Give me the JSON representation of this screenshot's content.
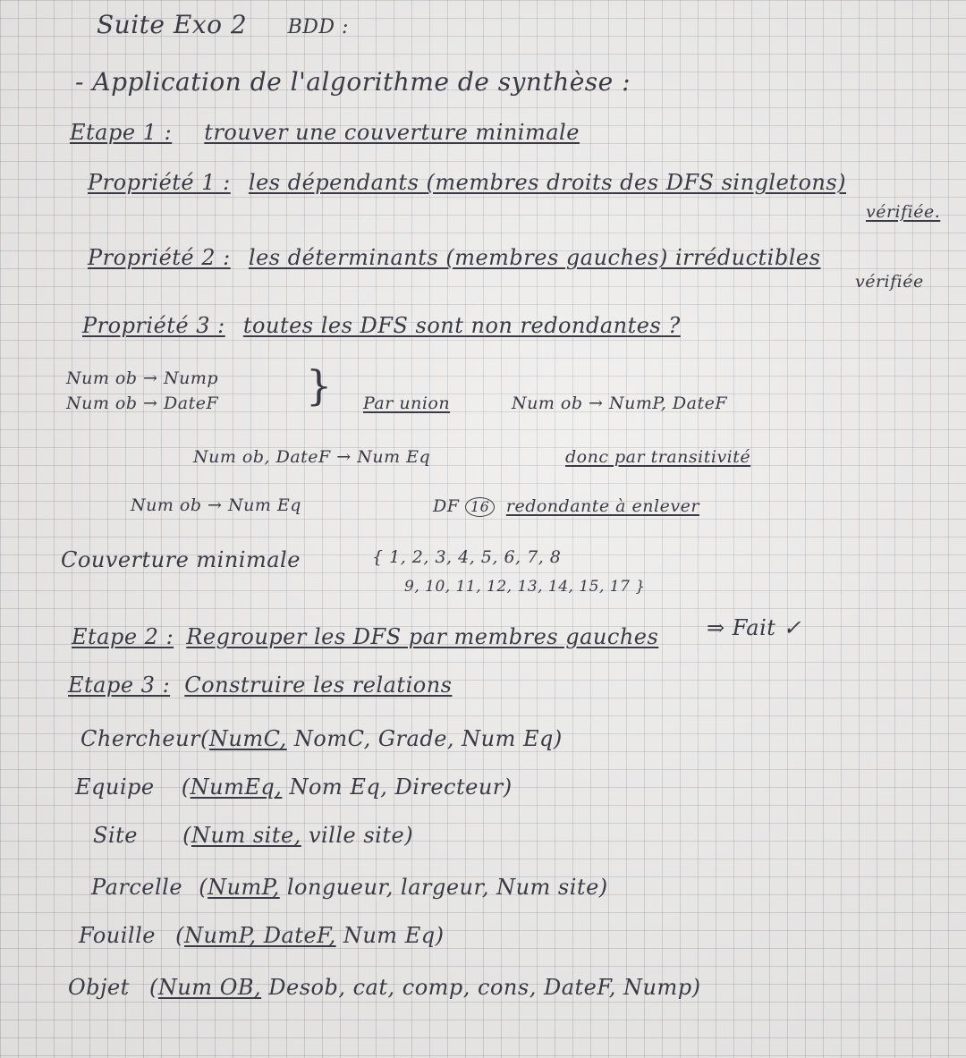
{
  "header": {
    "title": "Suite Exo 2",
    "subject": "BDD :"
  },
  "intro": "- Application de l'algorithme de synthèse :",
  "etape1": {
    "label": "Etape 1 :",
    "text": "trouver une couverture minimale"
  },
  "prop1": {
    "label": "Propriété 1 :",
    "text": "les dépendants (membres droits des DFS singletons)",
    "note": "vérifiée."
  },
  "prop2": {
    "label": "Propriété 2 :",
    "text": "les déterminants (membres gauches) irréductibles",
    "note": "vérifiée"
  },
  "prop3": {
    "label": "Propriété 3 :",
    "text": "toutes les DFS sont non redondantes ?"
  },
  "derivation": {
    "line1": "Num ob → Nump",
    "line2": "Num ob → DateF",
    "brace": "}",
    "union_label": "Par union",
    "union_result": "Num ob → NumP, DateF",
    "trans_left": "Num ob, DateF → Num Eq",
    "trans_right": "donc par transitivité",
    "result": "Num ob → Num Eq",
    "df_label": "DF",
    "df_number": "16",
    "df_note": "redondante à enlever"
  },
  "couverture": {
    "label": "Couverture minimale",
    "row1": "{ 1, 2, 3, 4, 5, 6, 7, 8",
    "row2": "9, 10, 11, 12, 13, 14, 15, 17 }"
  },
  "etape2": {
    "label": "Etape 2 :",
    "text": "Regrouper les DFS par membres gauches",
    "result": "⇒ Fait ✓"
  },
  "etape3": {
    "label": "Etape 3 :",
    "text": "Construire les relations"
  },
  "relations": [
    {
      "name": "Chercheur",
      "open": "(",
      "key": "NumC,",
      "rest": "NomC, Grade, Num Eq)"
    },
    {
      "name": "Equipe",
      "open": "(",
      "key": "NumEq,",
      "rest": "Nom Eq, Directeur)"
    },
    {
      "name": "Site",
      "open": "(",
      "key": "Num site,",
      "rest": "ville site)"
    },
    {
      "name": "Parcelle",
      "open": "(",
      "key": "NumP,",
      "rest": "longueur, largeur, Num site)"
    },
    {
      "name": "Fouille",
      "open": "(",
      "key": "NumP, DateF,",
      "rest": "Num Eq)"
    },
    {
      "name": "Objet",
      "open": "(",
      "key": "Num OB,",
      "rest": "Desob, cat, comp, cons, DateF, Nump)"
    }
  ]
}
